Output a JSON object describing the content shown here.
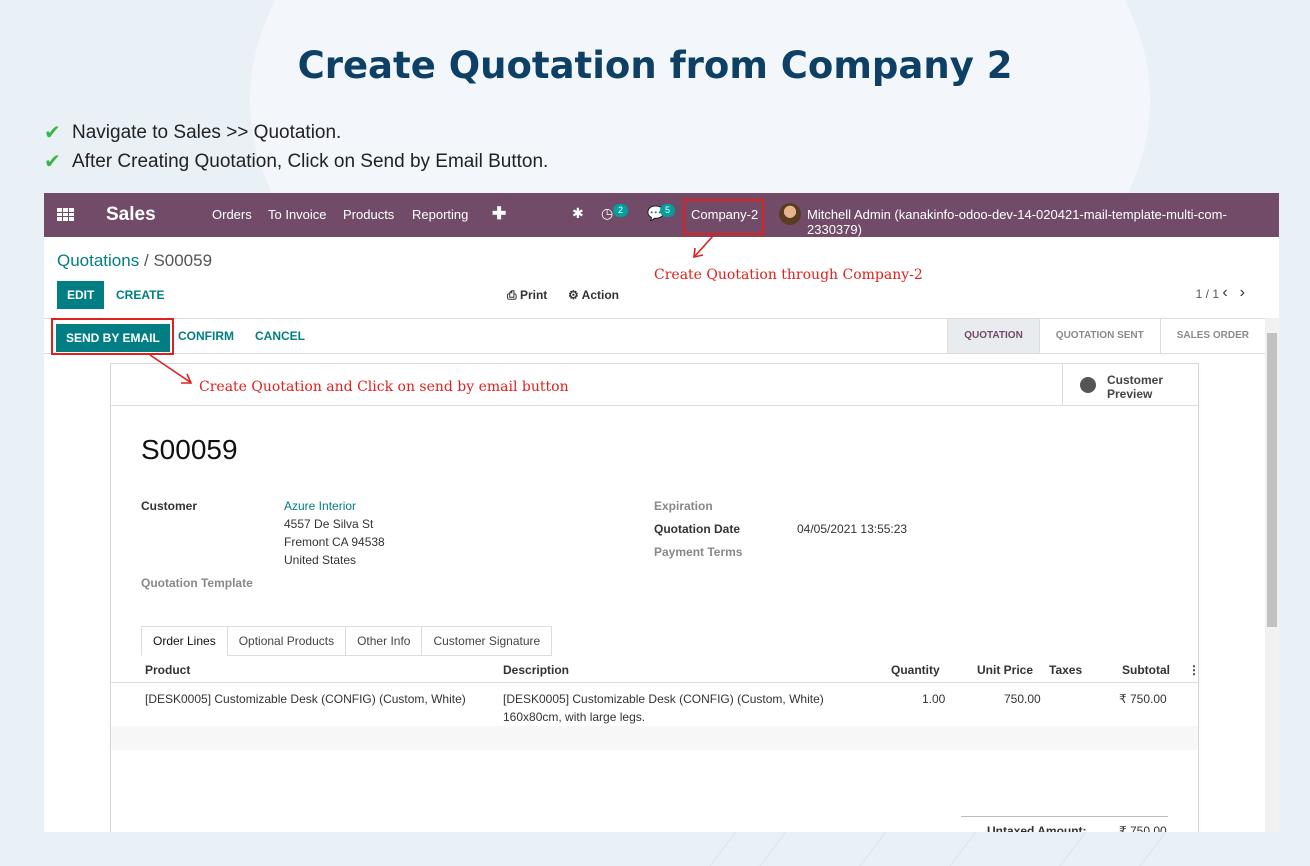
{
  "slide": {
    "title": "Create Quotation from Company 2",
    "steps": [
      "Navigate to Sales >> Quotation.",
      "After Creating Quotation, Click on Send by Email Button."
    ]
  },
  "navbar": {
    "brand": "Sales",
    "menu": [
      "Orders",
      "To Invoice",
      "Products",
      "Reporting"
    ],
    "activity_count": "2",
    "message_count": "5",
    "company": "Company-2",
    "user": "Mitchell Admin (kanakinfo-odoo-dev-14-020421-mail-template-multi-com-2330379)"
  },
  "control": {
    "breadcrumb_parent": "Quotations",
    "breadcrumb_sep": "/",
    "breadcrumb_current": "S00059",
    "edit": "EDIT",
    "create": "CREATE",
    "print": "Print",
    "action": "Action",
    "pager": "1 / 1"
  },
  "statusbar": {
    "send_email": "SEND BY EMAIL",
    "confirm": "CONFIRM",
    "cancel": "CANCEL",
    "stages": [
      "QUOTATION",
      "QUOTATION SENT",
      "SALES ORDER"
    ],
    "active_stage": "QUOTATION"
  },
  "sheet": {
    "preview_line1": "Customer",
    "preview_line2": "Preview",
    "name": "S00059",
    "customer_label": "Customer",
    "customer_name": "Azure Interior",
    "address": [
      "4557 De Silva St",
      "Fremont CA 94538",
      "United States"
    ],
    "template_label": "Quotation Template",
    "expiration_label": "Expiration",
    "date_label": "Quotation Date",
    "date_value": "04/05/2021 13:55:23",
    "terms_label": "Payment Terms",
    "tabs": [
      "Order Lines",
      "Optional Products",
      "Other Info",
      "Customer Signature"
    ],
    "columns": [
      "Product",
      "Description",
      "Quantity",
      "Unit Price",
      "Taxes",
      "Subtotal"
    ],
    "lines": [
      {
        "product": "[DESK0005] Customizable Desk (CONFIG) (Custom, White)",
        "description_1": "[DESK0005] Customizable Desk (CONFIG) (Custom, White)",
        "description_2": "160x80cm, with large legs.",
        "quantity": "1.00",
        "unit_price": "750.00",
        "taxes": "",
        "subtotal": "₹ 750.00"
      }
    ],
    "untaxed_label": "Untaxed Amount:",
    "untaxed_value": "₹ 750.00"
  },
  "annotations": {
    "company": "Create Quotation through Company-2",
    "send_email": "Create Quotation and Click on send by email button",
    "color": "#e0201e"
  },
  "colors": {
    "navbar": "#714b67",
    "primary": "#017e84",
    "title": "#0e4065",
    "check": "#3bb54a"
  }
}
